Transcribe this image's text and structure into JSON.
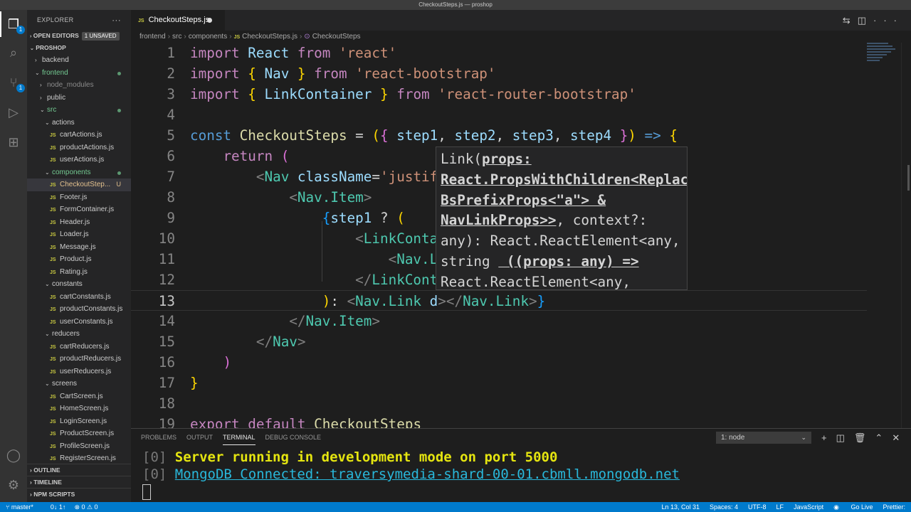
{
  "window": {
    "title": "CheckoutSteps.js — proshop"
  },
  "activity": {
    "explorer_badge": "1",
    "scm_badge": "1"
  },
  "sidebar": {
    "header": "EXPLORER",
    "open_editors": "OPEN EDITORS",
    "unsaved_badge": "1 UNSAVED",
    "project": "PROSHOP",
    "tree": [
      {
        "label": "backend",
        "type": "folder",
        "indent": 1,
        "open": false,
        "style": ""
      },
      {
        "label": "frontend",
        "type": "folder",
        "indent": 1,
        "open": true,
        "style": "green",
        "dot": true
      },
      {
        "label": "node_modules",
        "type": "folder",
        "indent": 2,
        "open": false,
        "style": "dim"
      },
      {
        "label": "public",
        "type": "folder",
        "indent": 2,
        "open": false,
        "style": ""
      },
      {
        "label": "src",
        "type": "folder",
        "indent": 2,
        "open": true,
        "style": "green",
        "dot": true
      },
      {
        "label": "actions",
        "type": "folder",
        "indent": 3,
        "open": true,
        "style": ""
      },
      {
        "label": "cartActions.js",
        "type": "file",
        "indent": 4,
        "style": ""
      },
      {
        "label": "productActions.js",
        "type": "file",
        "indent": 4,
        "style": ""
      },
      {
        "label": "userActions.js",
        "type": "file",
        "indent": 4,
        "style": ""
      },
      {
        "label": "components",
        "type": "folder",
        "indent": 3,
        "open": true,
        "style": "green",
        "dot": true
      },
      {
        "label": "CheckoutStep...",
        "type": "file",
        "indent": 4,
        "style": "selected",
        "u": "U"
      },
      {
        "label": "Footer.js",
        "type": "file",
        "indent": 4,
        "style": ""
      },
      {
        "label": "FormContainer.js",
        "type": "file",
        "indent": 4,
        "style": ""
      },
      {
        "label": "Header.js",
        "type": "file",
        "indent": 4,
        "style": ""
      },
      {
        "label": "Loader.js",
        "type": "file",
        "indent": 4,
        "style": ""
      },
      {
        "label": "Message.js",
        "type": "file",
        "indent": 4,
        "style": ""
      },
      {
        "label": "Product.js",
        "type": "file",
        "indent": 4,
        "style": ""
      },
      {
        "label": "Rating.js",
        "type": "file",
        "indent": 4,
        "style": ""
      },
      {
        "label": "constants",
        "type": "folder",
        "indent": 3,
        "open": true,
        "style": ""
      },
      {
        "label": "cartConstants.js",
        "type": "file",
        "indent": 4,
        "style": ""
      },
      {
        "label": "productConstants.js",
        "type": "file",
        "indent": 4,
        "style": ""
      },
      {
        "label": "userConstants.js",
        "type": "file",
        "indent": 4,
        "style": ""
      },
      {
        "label": "reducers",
        "type": "folder",
        "indent": 3,
        "open": true,
        "style": ""
      },
      {
        "label": "cartReducers.js",
        "type": "file",
        "indent": 4,
        "style": ""
      },
      {
        "label": "productReducers.js",
        "type": "file",
        "indent": 4,
        "style": ""
      },
      {
        "label": "userReducers.js",
        "type": "file",
        "indent": 4,
        "style": ""
      },
      {
        "label": "screens",
        "type": "folder",
        "indent": 3,
        "open": true,
        "style": ""
      },
      {
        "label": "CartScreen.js",
        "type": "file",
        "indent": 4,
        "style": ""
      },
      {
        "label": "HomeScreen.js",
        "type": "file",
        "indent": 4,
        "style": ""
      },
      {
        "label": "LoginScreen.js",
        "type": "file",
        "indent": 4,
        "style": ""
      },
      {
        "label": "ProductScreen.js",
        "type": "file",
        "indent": 4,
        "style": ""
      },
      {
        "label": "ProfileScreen.js",
        "type": "file",
        "indent": 4,
        "style": ""
      },
      {
        "label": "RegisterScreen.js",
        "type": "file",
        "indent": 4,
        "style": ""
      }
    ],
    "outline": "OUTLINE",
    "timeline": "TIMELINE",
    "npm_scripts": "NPM SCRIPTS"
  },
  "tab": {
    "label": "CheckoutSteps.js",
    "lang": "JS"
  },
  "breadcrumb": {
    "parts": [
      "frontend",
      "src",
      "components"
    ],
    "file": "CheckoutSteps.js",
    "symbol": "CheckoutSteps"
  },
  "editor": {
    "current_line": 13
  },
  "hover": {
    "lines": [
      "Link(|props:|",
      "|React.PropsWithChildren<Replac|",
      "|BsPrefixProps<\"a\"> &|",
      "|NavLinkProps>>|, context?:",
      "any): React.ReactElement<any,",
      "string | ((props: any) =>",
      "React.ReactElement<any,"
    ]
  },
  "panel": {
    "tabs": [
      "PROBLEMS",
      "OUTPUT",
      "TERMINAL",
      "DEBUG CONSOLE"
    ],
    "active_tab": "TERMINAL",
    "terminal_select": "1: node",
    "lines": [
      {
        "prefix": "[0] ",
        "text": "Server running in development mode on port 5000",
        "style": "y"
      },
      {
        "prefix": "[0] ",
        "text": "MongoDB Connected: traversymedia-shard-00-01.cbmll.mongodb.net",
        "style": "c"
      }
    ]
  },
  "status": {
    "branch": "master*",
    "sync": "0↓ 1↑",
    "errors": "⊗ 0 ⚠ 0",
    "position": "Ln 13, Col 31",
    "spaces": "Spaces: 4",
    "encoding": "UTF-8",
    "eol": "LF",
    "language": "JavaScript",
    "live": "Go Live",
    "prettier": "Prettier:"
  }
}
